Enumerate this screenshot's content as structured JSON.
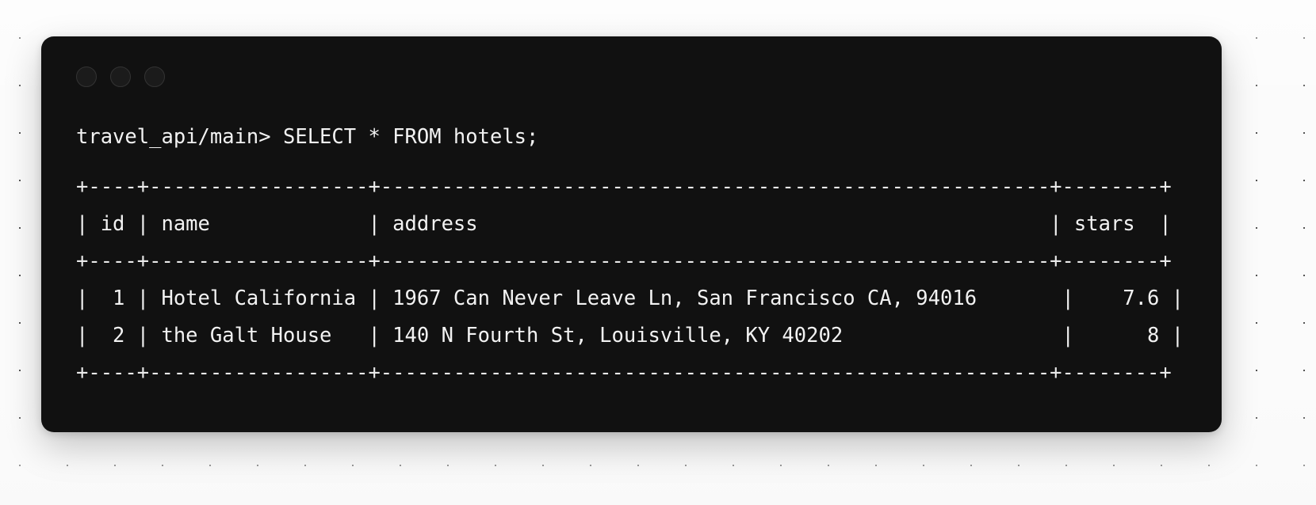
{
  "window": {
    "controls": [
      {
        "name": "close-button",
        "color": "#1b1b1b"
      },
      {
        "name": "minimize-button",
        "color": "#1b1b1b"
      },
      {
        "name": "maximize-button",
        "color": "#1b1b1b"
      }
    ],
    "background": "#111111"
  },
  "theme": {
    "page_background": "#fbfbfb",
    "terminal_background": "#111111",
    "terminal_text": "#f2f2f2",
    "dot_grid": "#2a2a2a"
  },
  "terminal": {
    "prompt": "travel_api/main>",
    "command": "SELECT * FROM hotels;",
    "prompt_line": "travel_api/main> SELECT * FROM hotels;",
    "table": {
      "top_rule": "+----+------------------+-------------------------------------------------------+--------+",
      "header_row": "| id | name             | address                                               | stars  |",
      "mid_rule": "+----+------------------+-------------------------------------------------------+--------+",
      "row_1": "|  1 | Hotel California | 1967 Can Never Leave Ln, San Francisco CA, 94016       |    7.6 |",
      "row_2": "|  2 | the Galt House   | 140 N Fourth St, Louisville, KY 40202                  |      8 |",
      "bottom_rule": "+----+------------------+-------------------------------------------------------+--------+",
      "columns": [
        "id",
        "name",
        "address",
        "stars"
      ],
      "rows": [
        {
          "id": "1",
          "name": "Hotel California",
          "address": "1967 Can Never Leave Ln, San Francisco CA, 94016",
          "stars": "7.6"
        },
        {
          "id": "2",
          "name": "the Galt House",
          "address": "140 N Fourth St, Louisville, KY 40202",
          "stars": "8"
        }
      ]
    }
  }
}
